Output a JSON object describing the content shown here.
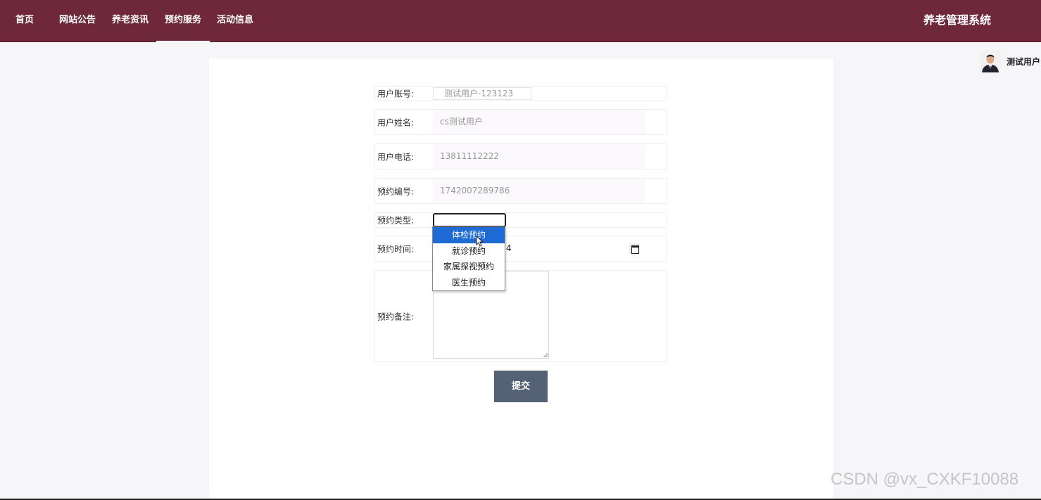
{
  "nav": {
    "items": [
      {
        "label": "首页"
      },
      {
        "label": "网站公告"
      },
      {
        "label": "养老资讯"
      },
      {
        "label": "预约服务",
        "active": true
      },
      {
        "label": "活动信息"
      }
    ],
    "brand": "养老管理系统"
  },
  "user": {
    "name": "测试用户"
  },
  "form": {
    "account": {
      "label": "用户账号:",
      "value": "测试用户-123123"
    },
    "name": {
      "label": "用户姓名:",
      "value": "cs测试用户"
    },
    "phone": {
      "label": "用户电话:",
      "value": "13811112222"
    },
    "booking_no": {
      "label": "预约编号:",
      "value": "1742007289786"
    },
    "booking_type": {
      "label": "预约类型:",
      "value": "",
      "options": [
        "体检预约",
        "就诊预约",
        "家属探视预约",
        "医生预约"
      ],
      "highlighted": "体检预约"
    },
    "booking_time": {
      "label": "预约时间:",
      "value_visible": "4"
    },
    "remark": {
      "label": "预约备注:",
      "value": ""
    },
    "submit_label": "提交"
  },
  "watermark": "CSDN @vx_CXKF10088",
  "colors": {
    "topbar": "#6e2839",
    "submit": "#556175",
    "option_highlight": "#1e6bd6"
  }
}
